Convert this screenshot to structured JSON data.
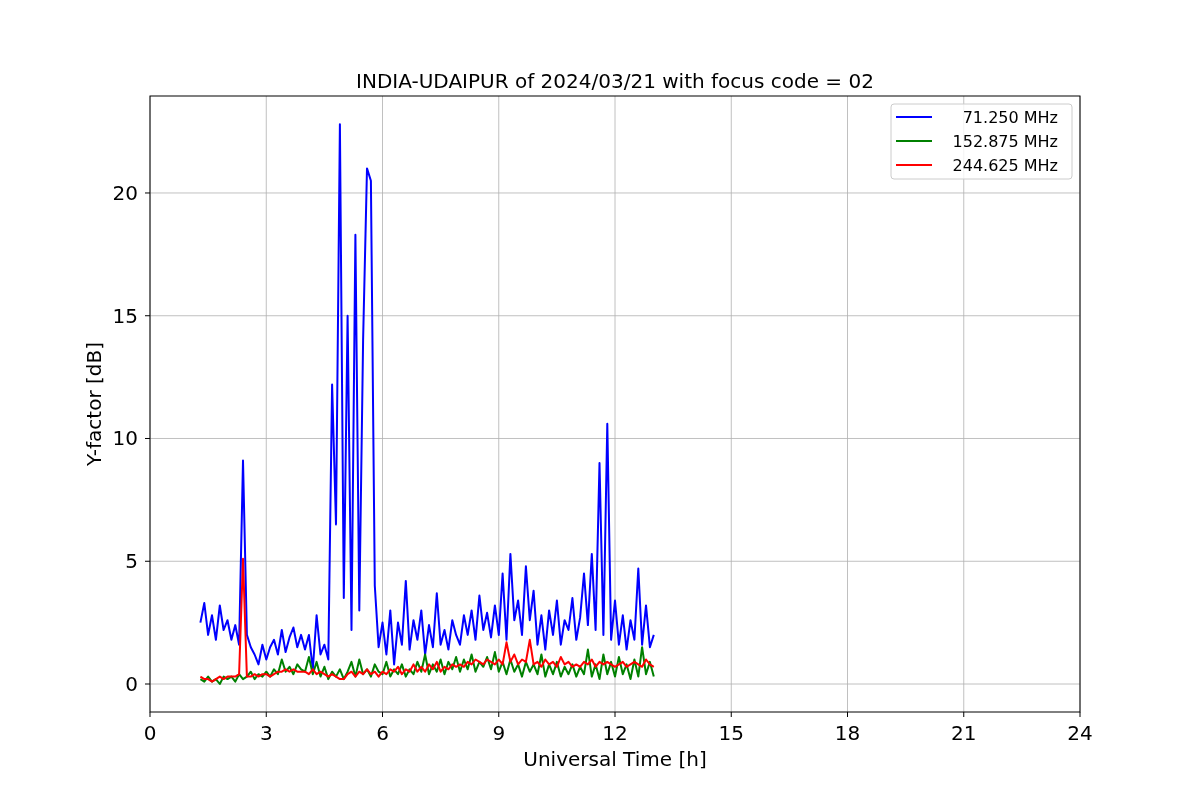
{
  "chart_data": {
    "type": "line",
    "title": "INDIA-UDAIPUR of 2024/03/21 with focus code = 02",
    "xlabel": "Universal Time [h]",
    "ylabel": "Y-factor [dB]",
    "x": [
      1.3,
      1.4,
      1.5,
      1.6,
      1.7,
      1.8,
      1.9,
      2.0,
      2.1,
      2.2,
      2.3,
      2.4,
      2.5,
      2.6,
      2.7,
      2.8,
      2.9,
      3.0,
      3.1,
      3.2,
      3.3,
      3.4,
      3.5,
      3.6,
      3.7,
      3.8,
      3.9,
      4.0,
      4.1,
      4.2,
      4.3,
      4.4,
      4.5,
      4.6,
      4.7,
      4.8,
      4.9,
      5.0,
      5.1,
      5.2,
      5.3,
      5.4,
      5.5,
      5.6,
      5.7,
      5.8,
      5.9,
      6.0,
      6.1,
      6.2,
      6.3,
      6.4,
      6.5,
      6.6,
      6.7,
      6.8,
      6.9,
      7.0,
      7.1,
      7.2,
      7.3,
      7.4,
      7.5,
      7.6,
      7.7,
      7.8,
      7.9,
      8.0,
      8.1,
      8.2,
      8.3,
      8.4,
      8.5,
      8.6,
      8.7,
      8.8,
      8.9,
      9.0,
      9.1,
      9.2,
      9.3,
      9.4,
      9.5,
      9.6,
      9.7,
      9.8,
      9.9,
      10.0,
      10.1,
      10.2,
      10.3,
      10.4,
      10.5,
      10.6,
      10.7,
      10.8,
      10.9,
      11.0,
      11.1,
      11.2,
      11.3,
      11.4,
      11.5,
      11.6,
      11.7,
      11.8,
      11.9,
      12.0,
      12.1,
      12.2,
      12.3,
      12.4,
      12.5,
      12.6,
      12.7,
      12.8,
      12.9,
      13.0
    ],
    "series": [
      {
        "name": "71.250 MHz",
        "color": "#0000ff",
        "values": [
          2.5,
          3.3,
          2.0,
          2.8,
          1.8,
          3.2,
          2.2,
          2.6,
          1.8,
          2.4,
          1.6,
          9.1,
          2.0,
          1.5,
          1.2,
          0.8,
          1.6,
          1.0,
          1.5,
          1.8,
          1.2,
          2.2,
          1.3,
          1.9,
          2.3,
          1.5,
          2.0,
          1.4,
          2.0,
          0.6,
          2.8,
          1.2,
          1.6,
          1.0,
          12.2,
          6.5,
          22.8,
          3.5,
          15.0,
          2.2,
          18.3,
          3.0,
          14.0,
          21.0,
          20.5,
          4.0,
          1.5,
          2.5,
          1.2,
          3.0,
          0.8,
          2.5,
          1.6,
          4.2,
          1.4,
          2.6,
          1.8,
          3.0,
          1.2,
          2.4,
          1.5,
          3.7,
          1.6,
          2.2,
          1.4,
          2.6,
          2.0,
          1.6,
          2.8,
          2.0,
          3.0,
          1.8,
          3.6,
          2.2,
          2.9,
          1.9,
          3.2,
          2.0,
          4.5,
          1.8,
          5.3,
          2.6,
          3.4,
          2.0,
          4.8,
          2.6,
          3.8,
          1.6,
          2.8,
          1.4,
          3.0,
          2.0,
          3.4,
          1.6,
          2.6,
          2.2,
          3.5,
          1.8,
          2.7,
          4.5,
          2.4,
          5.3,
          2.2,
          9.0,
          2.0,
          10.6,
          1.8,
          3.4,
          1.6,
          2.8,
          1.4,
          2.6,
          1.8,
          4.7,
          1.6,
          3.2,
          1.5,
          2.0
        ]
      },
      {
        "name": "152.875 MHz",
        "color": "#008000",
        "values": [
          0.2,
          0.1,
          0.3,
          0.1,
          0.2,
          0.0,
          0.3,
          0.2,
          0.3,
          0.1,
          0.4,
          0.2,
          0.3,
          0.5,
          0.2,
          0.4,
          0.3,
          0.5,
          0.3,
          0.6,
          0.4,
          1.0,
          0.5,
          0.7,
          0.4,
          0.8,
          0.6,
          0.5,
          1.1,
          0.4,
          0.9,
          0.3,
          0.7,
          0.2,
          0.5,
          0.3,
          0.6,
          0.2,
          0.5,
          0.9,
          0.3,
          1.0,
          0.4,
          0.6,
          0.3,
          0.8,
          0.5,
          0.4,
          0.9,
          0.3,
          0.6,
          0.4,
          0.8,
          0.3,
          0.6,
          0.4,
          0.9,
          0.5,
          1.2,
          0.4,
          0.8,
          0.5,
          1.0,
          0.4,
          0.9,
          0.6,
          1.1,
          0.5,
          1.0,
          0.6,
          1.2,
          0.5,
          0.9,
          0.7,
          1.1,
          0.6,
          1.3,
          0.5,
          0.9,
          0.4,
          1.0,
          0.5,
          0.8,
          0.3,
          0.9,
          0.5,
          0.8,
          0.4,
          1.2,
          0.3,
          0.8,
          0.4,
          0.9,
          0.3,
          0.7,
          0.4,
          0.8,
          0.3,
          0.7,
          0.4,
          1.4,
          0.3,
          0.8,
          0.2,
          1.2,
          0.4,
          0.9,
          0.3,
          1.1,
          0.4,
          0.8,
          0.2,
          1.0,
          0.3,
          1.5,
          0.4,
          0.9,
          0.3
        ]
      },
      {
        "name": "244.625 MHz",
        "color": "#ff0000",
        "values": [
          0.3,
          0.2,
          0.2,
          0.1,
          0.2,
          0.3,
          0.2,
          0.3,
          0.3,
          0.3,
          0.4,
          5.1,
          0.3,
          0.3,
          0.4,
          0.3,
          0.4,
          0.4,
          0.3,
          0.4,
          0.5,
          0.5,
          0.6,
          0.5,
          0.6,
          0.5,
          0.5,
          0.5,
          0.4,
          0.6,
          0.4,
          0.5,
          0.4,
          0.3,
          0.4,
          0.3,
          0.2,
          0.2,
          0.4,
          0.5,
          0.3,
          0.5,
          0.4,
          0.6,
          0.4,
          0.5,
          0.3,
          0.5,
          0.4,
          0.6,
          0.5,
          0.7,
          0.4,
          0.6,
          0.5,
          0.8,
          0.5,
          0.7,
          0.5,
          0.8,
          0.6,
          0.9,
          0.5,
          0.7,
          0.6,
          0.8,
          0.7,
          0.8,
          0.7,
          0.9,
          0.8,
          1.0,
          0.9,
          0.8,
          1.0,
          0.9,
          0.8,
          1.0,
          0.8,
          1.7,
          0.9,
          1.2,
          0.8,
          1.0,
          0.9,
          1.8,
          0.8,
          0.9,
          0.7,
          1.0,
          0.8,
          0.9,
          0.7,
          1.1,
          0.8,
          0.9,
          0.7,
          0.8,
          0.7,
          0.9,
          0.8,
          1.0,
          0.7,
          0.9,
          0.8,
          0.9,
          0.8,
          0.7,
          0.8,
          0.9,
          0.7,
          0.8,
          0.9,
          0.8,
          0.7,
          1.0,
          0.8,
          0.7
        ]
      }
    ],
    "grid": true,
    "legend": true,
    "xlim": [
      0,
      24
    ],
    "ylim": [
      -1.14,
      23.95
    ],
    "xticks": [
      0,
      3,
      6,
      9,
      12,
      15,
      18,
      21,
      24
    ],
    "yticks": [
      0,
      5,
      10,
      15,
      20
    ]
  }
}
